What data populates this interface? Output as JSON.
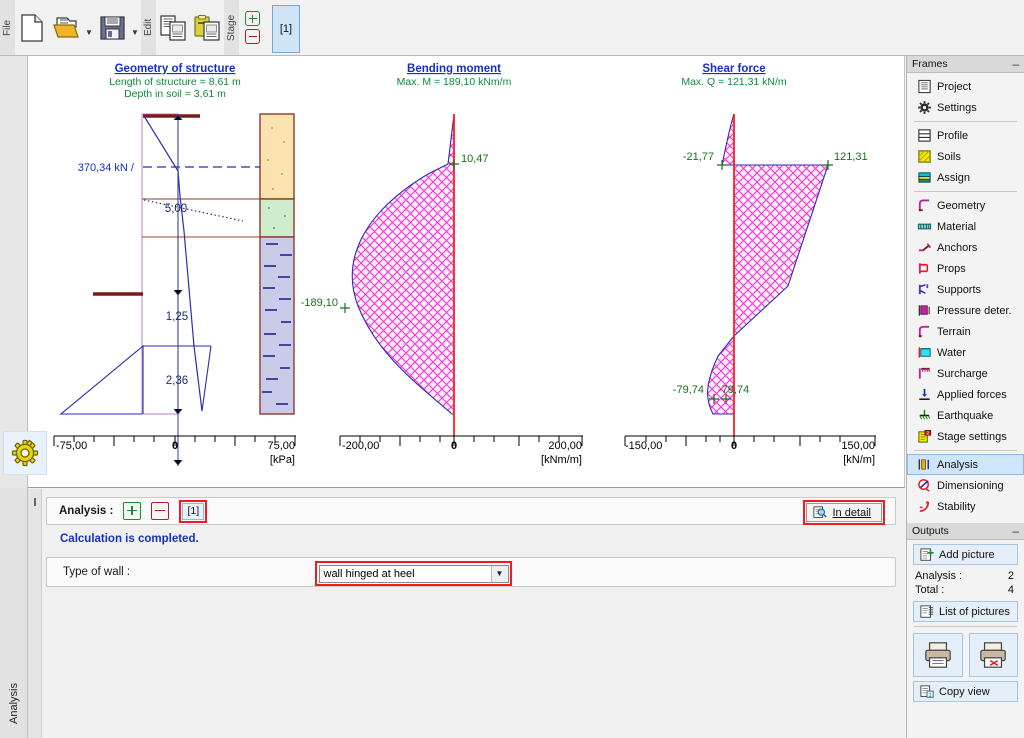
{
  "toolbar": {
    "groups": [
      {
        "caption": "File",
        "buttons": [
          {
            "name": "new-file-icon",
            "label": "New"
          },
          {
            "name": "open-file-icon",
            "label": "Open"
          },
          {
            "name": "save-file-icon",
            "label": "Save"
          }
        ]
      },
      {
        "caption": "Edit",
        "buttons": [
          {
            "name": "copy-icon",
            "label": "Copy"
          },
          {
            "name": "paste-icon",
            "label": "Paste"
          }
        ]
      },
      {
        "caption": "Stage",
        "buttons": []
      }
    ],
    "stage_add_label": "+",
    "stage_remove_label": "−",
    "stage_tab_label": "[1]"
  },
  "left_rail": {
    "gear_icon": "gear-icon",
    "vertical_tab_label": "Analysis"
  },
  "chart_data": [
    {
      "type": "area",
      "name": "geometry-of-structure",
      "title": "Geometry of structure",
      "subtitle_lines": [
        "Length of structure = 8,61 m",
        "Depth in soil = 3,61 m"
      ],
      "xlabel": "[kPa]",
      "xlim": [
        -75.0,
        75.0
      ],
      "axis_ticks": [
        "-75,00",
        "0",
        "75,00"
      ],
      "annotations": [
        {
          "text": "370,34 kN /",
          "color": "#1531c8"
        },
        {
          "text": "5,00",
          "color": "#1a2a6e"
        },
        {
          "text": "1,25",
          "color": "#1a2a6e"
        },
        {
          "text": "2,36",
          "color": "#1a2a6e"
        }
      ],
      "soil_layers": [
        {
          "name": "layer-1-sand",
          "color": "#fbe3b0"
        },
        {
          "name": "layer-2-clayey",
          "color": "#cfeccc"
        },
        {
          "name": "layer-3-silt",
          "color": "#c9cbe8"
        }
      ]
    },
    {
      "type": "area",
      "name": "bending-moment",
      "title": "Bending moment",
      "subtitle_lines": [
        "Max. M = 189,10 kNm/m"
      ],
      "xlabel": "[kNm/m]",
      "xlim": [
        -200.0,
        200.0
      ],
      "axis_ticks": [
        "-200,00",
        "0",
        "200,00"
      ],
      "data_labels": [
        {
          "text": "10,47",
          "value": 10.47
        },
        {
          "text": "-189,10",
          "value": -189.1
        }
      ],
      "max_value": 189.1,
      "fill": "#ff2fd0",
      "outline": "#2b2bbb"
    },
    {
      "type": "area",
      "name": "shear-force",
      "title": "Shear force",
      "subtitle_lines": [
        "Max. Q = 121,31 kN/m"
      ],
      "xlabel": "[kN/m]",
      "xlim": [
        -150.0,
        150.0
      ],
      "axis_ticks": [
        "-150,00",
        "0",
        "150,00"
      ],
      "data_labels": [
        {
          "text": "-21,77",
          "value": -21.77
        },
        {
          "text": "121,31",
          "value": 121.31
        },
        {
          "text": "-79,74",
          "value": -79.74
        },
        {
          "text": "-79,74",
          "value": -79.74
        }
      ],
      "max_value": 121.31,
      "fill": "#ff2fd0",
      "outline": "#2b2bbb"
    }
  ],
  "bottom_panel": {
    "analysis_label": "Analysis :",
    "add_stage_label": "+",
    "remove_stage_label": "−",
    "stage_chip_label": "[1]",
    "in_detail_label": "In detail",
    "in_detail_icon": "magnifier-detail-icon",
    "calculation_status": "Calculation is completed.",
    "wall_type_label": "Type of wall  :",
    "wall_type_value": "wall hinged at heel",
    "wall_type_options": [
      "wall hinged at heel"
    ]
  },
  "sidebar": {
    "frames_title": "Frames",
    "collapse_label": "–",
    "items": [
      {
        "label": "Project",
        "icon": "project-icon",
        "active": false
      },
      {
        "label": "Settings",
        "icon": "settings-gear-icon",
        "active": false
      },
      {
        "sep": true
      },
      {
        "label": "Profile",
        "icon": "profile-icon",
        "active": false
      },
      {
        "label": "Soils",
        "icon": "soils-icon",
        "active": false
      },
      {
        "label": "Assign",
        "icon": "assign-icon",
        "active": false
      },
      {
        "sep": true
      },
      {
        "label": "Geometry",
        "icon": "geometry-icon",
        "active": false
      },
      {
        "label": "Material",
        "icon": "material-icon",
        "active": false
      },
      {
        "label": "Anchors",
        "icon": "anchors-icon",
        "active": false
      },
      {
        "label": "Props",
        "icon": "props-icon",
        "active": false
      },
      {
        "label": "Supports",
        "icon": "supports-icon",
        "active": false
      },
      {
        "label": "Pressure deter.",
        "icon": "pressure-icon",
        "active": false
      },
      {
        "label": "Terrain",
        "icon": "terrain-icon",
        "active": false
      },
      {
        "label": "Water",
        "icon": "water-icon",
        "active": false
      },
      {
        "label": "Surcharge",
        "icon": "surcharge-icon",
        "active": false
      },
      {
        "label": "Applied forces",
        "icon": "applied-forces-icon",
        "active": false
      },
      {
        "label": "Earthquake",
        "icon": "earthquake-icon",
        "active": false
      },
      {
        "label": "Stage settings",
        "icon": "stage-settings-icon",
        "active": false
      },
      {
        "sep": true
      },
      {
        "label": "Analysis",
        "icon": "analysis-icon",
        "active": true
      },
      {
        "label": "Dimensioning",
        "icon": "dimensioning-icon",
        "active": false
      },
      {
        "label": "Stability",
        "icon": "stability-icon",
        "active": false
      }
    ],
    "outputs": {
      "title": "Outputs",
      "collapse_label": "–",
      "add_picture_label": "Add picture",
      "analysis_count_label": "Analysis :",
      "analysis_count_value": "2",
      "total_label": "Total :",
      "total_value": "4",
      "list_of_pictures_label": "List of pictures",
      "copy_view_label": "Copy view"
    }
  },
  "colors": {
    "title_blue": "#1531c8",
    "subtitle_green": "#0f8a3c",
    "label_green": "#16701f",
    "highlight_red": "#ee1c1c",
    "diagram_fill": "#ff2fd0",
    "diagram_outline": "#2b2bbb",
    "wall_red": "#ff2020",
    "structure_blue": "#2b2bbb"
  }
}
